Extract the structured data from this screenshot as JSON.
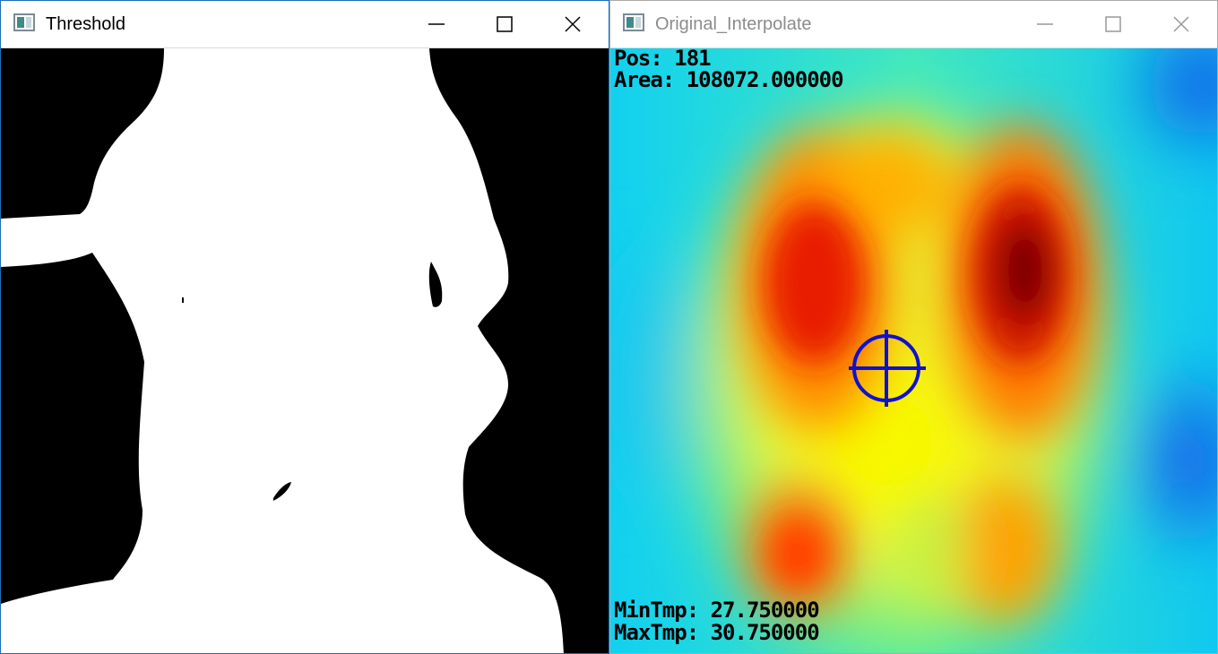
{
  "windows": {
    "threshold": {
      "title": "Threshold",
      "icon": "app-window-icon",
      "controls": [
        "minimize-icon",
        "maximize-icon",
        "close-icon"
      ]
    },
    "interpolate": {
      "title": "Original_Interpolate",
      "icon": "app-window-icon",
      "controls": [
        "minimize-icon",
        "maximize-icon",
        "close-icon"
      ],
      "overlay": {
        "pos": "Pos: 181",
        "area": "Area: 108072.000000",
        "min_tmp": "MinTmp: 27.750000",
        "max_tmp": "MaxTmp: 30.750000"
      },
      "crosshair_color": "#1010d0",
      "colormap": "jet"
    }
  },
  "colors": {
    "active_border": "#1b6fb5",
    "mask_foreground": "#ffffff",
    "mask_background": "#000000"
  }
}
